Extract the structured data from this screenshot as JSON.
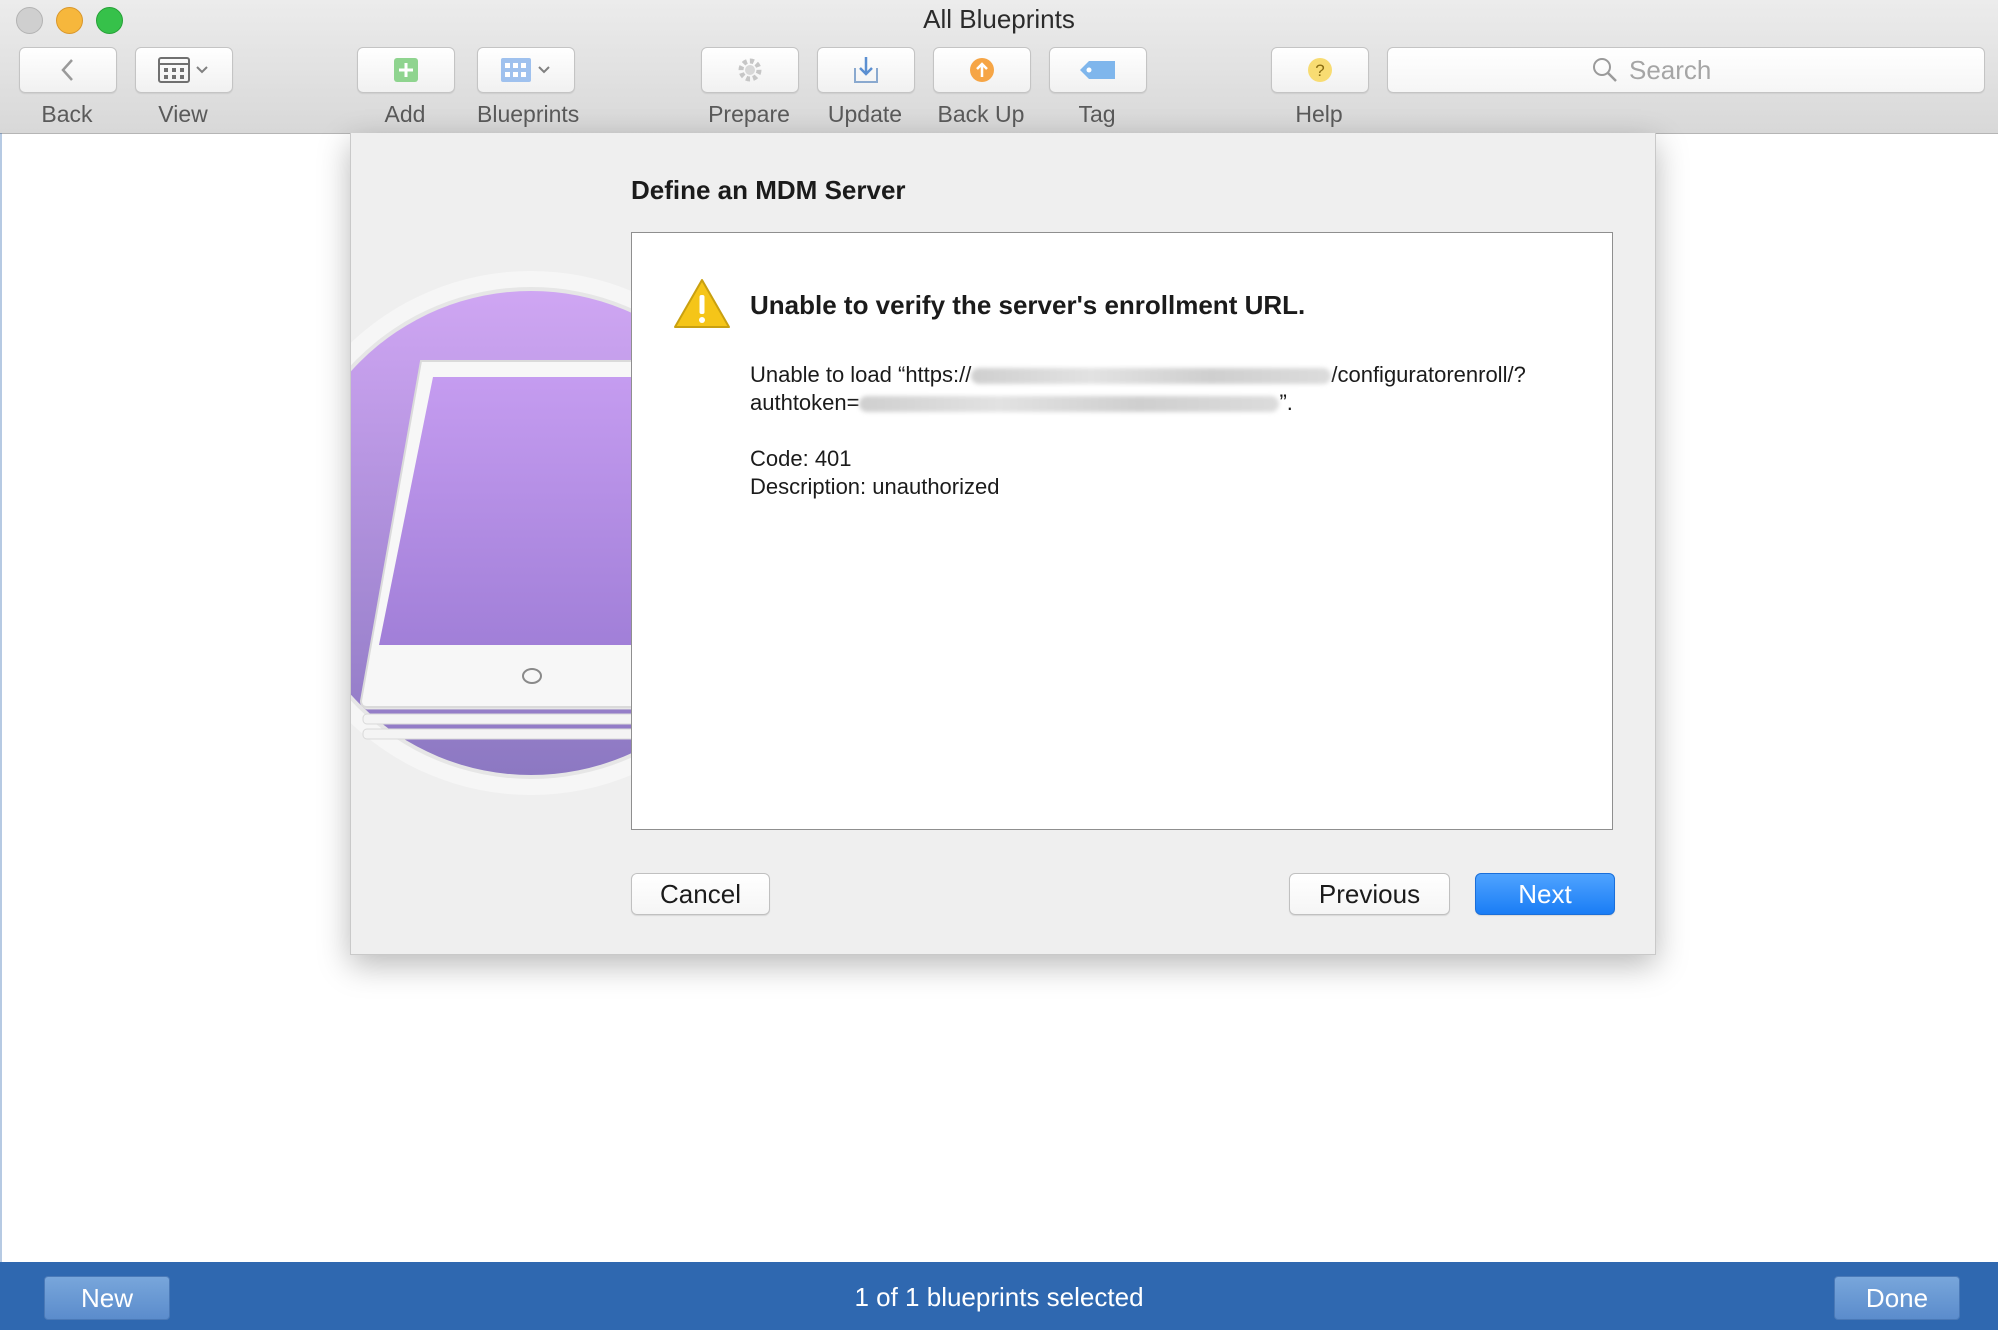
{
  "window": {
    "title": "All Blueprints"
  },
  "toolbar": {
    "back_label": "Back",
    "view_label": "View",
    "add_label": "Add",
    "blueprints_label": "Blueprints",
    "prepare_label": "Prepare",
    "update_label": "Update",
    "backup_label": "Back Up",
    "tag_label": "Tag",
    "help_label": "Help"
  },
  "search": {
    "placeholder": "Search",
    "value": ""
  },
  "sheet": {
    "title": "Define an MDM Server",
    "error_heading": "Unable to verify the server's enrollment URL.",
    "message_prefix": "Unable to load “https://",
    "message_url_path": "/configuratorenroll/?",
    "message_token_prefix": "authtoken=",
    "message_suffix": "”.",
    "code": "Code: 401",
    "description": "Description: unauthorized",
    "cancel_label": "Cancel",
    "previous_label": "Previous",
    "next_label": "Next"
  },
  "bottom_bar": {
    "new_label": "New",
    "status": "1 of 1 blueprints selected",
    "done_label": "Done"
  },
  "colors": {
    "accent": "#1a7df5",
    "bottom_bar": "#2f68b0",
    "warning": "#f5c518",
    "illustration_purple": "#b48be0"
  }
}
